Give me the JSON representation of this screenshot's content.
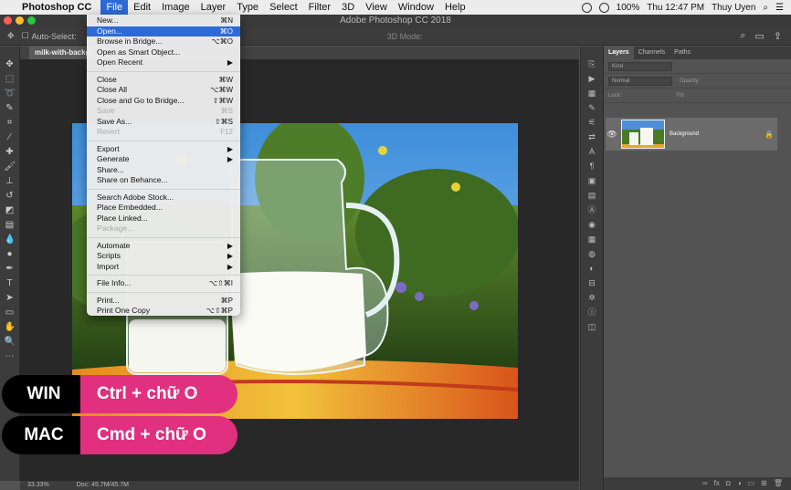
{
  "menubar": {
    "app_name": "Photoshop CC",
    "items": [
      "File",
      "Edit",
      "Image",
      "Layer",
      "Type",
      "Select",
      "Filter",
      "3D",
      "View",
      "Window",
      "Help"
    ],
    "battery": "100%",
    "clock": "Thu 12:47 PM",
    "user": "Thuy Uyen"
  },
  "window": {
    "title": "Adobe Photoshop CC 2018"
  },
  "options_bar": {
    "auto_select": "Auto-Select:",
    "mode_3d": "3D Mode:"
  },
  "document": {
    "tab": "milk-with-backgr…"
  },
  "status": {
    "zoom": "33.33%",
    "doc": "Doc: 45.7M/45.7M"
  },
  "layers_panel": {
    "tabs": [
      "Layers",
      "Channels",
      "Paths"
    ],
    "kind": "Kind",
    "blend": "Normal",
    "opacity_label": "Opacity:",
    "lock_label": "Lock:",
    "fill_label": "Fill:",
    "layer_name": "Background"
  },
  "file_menu": {
    "items": [
      {
        "label": "New...",
        "shortcut": "⌘N"
      },
      {
        "label": "Open...",
        "shortcut": "⌘O",
        "active": true
      },
      {
        "label": "Browse in Bridge...",
        "shortcut": "⌥⌘O"
      },
      {
        "label": "Open as Smart Object...",
        "shortcut": ""
      },
      {
        "label": "Open Recent",
        "shortcut": "▶"
      },
      {
        "sep": true
      },
      {
        "label": "Close",
        "shortcut": "⌘W"
      },
      {
        "label": "Close All",
        "shortcut": "⌥⌘W"
      },
      {
        "label": "Close and Go to Bridge...",
        "shortcut": "⇧⌘W"
      },
      {
        "label": "Save",
        "shortcut": "⌘S",
        "disabled": true
      },
      {
        "label": "Save As...",
        "shortcut": "⇧⌘S"
      },
      {
        "label": "Revert",
        "shortcut": "F12",
        "disabled": true
      },
      {
        "sep": true
      },
      {
        "label": "Export",
        "shortcut": "▶"
      },
      {
        "label": "Generate",
        "shortcut": "▶"
      },
      {
        "label": "Share...",
        "shortcut": ""
      },
      {
        "label": "Share on Behance...",
        "shortcut": ""
      },
      {
        "sep": true
      },
      {
        "label": "Search Adobe Stock...",
        "shortcut": ""
      },
      {
        "label": "Place Embedded...",
        "shortcut": ""
      },
      {
        "label": "Place Linked...",
        "shortcut": ""
      },
      {
        "label": "Package...",
        "shortcut": "",
        "disabled": true
      },
      {
        "sep": true
      },
      {
        "label": "Automate",
        "shortcut": "▶"
      },
      {
        "label": "Scripts",
        "shortcut": "▶"
      },
      {
        "label": "Import",
        "shortcut": "▶"
      },
      {
        "sep": true
      },
      {
        "label": "File Info...",
        "shortcut": "⌥⇧⌘I"
      },
      {
        "sep": true
      },
      {
        "label": "Print...",
        "shortcut": "⌘P"
      },
      {
        "label": "Print One Copy",
        "shortcut": "⌥⇧⌘P"
      }
    ]
  },
  "overlay": {
    "win_key": "WIN",
    "win_value": "Ctrl + chữ O",
    "mac_key": "MAC",
    "mac_value": "Cmd + chữ O"
  },
  "colors": {
    "accent": "#2d6ad8",
    "pill": "#e0307f"
  }
}
